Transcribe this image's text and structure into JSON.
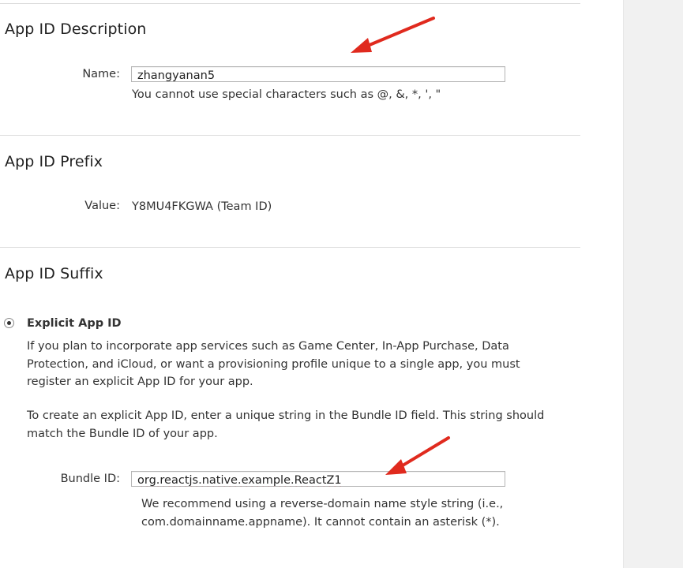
{
  "description": {
    "heading": "App ID Description",
    "name_label": "Name:",
    "name_value": "zhangyanan5",
    "name_hint": "You cannot use special characters such as @, &, *, ', \""
  },
  "prefix": {
    "heading": "App ID Prefix",
    "value_label": "Value:",
    "value": "Y8MU4FKGWA (Team ID)"
  },
  "suffix": {
    "heading": "App ID Suffix",
    "option_label": "Explicit App ID",
    "option_selected": true,
    "para1": "If you plan to incorporate app services such as Game Center, In-App Purchase, Data Protection, and iCloud, or want a provisioning profile unique to a single app, you must register an explicit App ID for your app.",
    "para2": "To create an explicit App ID, enter a unique string in the Bundle ID field. This string should match the Bundle ID of your app.",
    "bundle_label": "Bundle ID:",
    "bundle_value": "org.reactjs.native.example.ReactZ1",
    "bundle_hint": "We recommend using a reverse-domain name style string (i.e., com.domainname.appname). It cannot contain an asterisk (*)."
  },
  "annotations": {
    "arrow_color": "#e02a1e"
  }
}
